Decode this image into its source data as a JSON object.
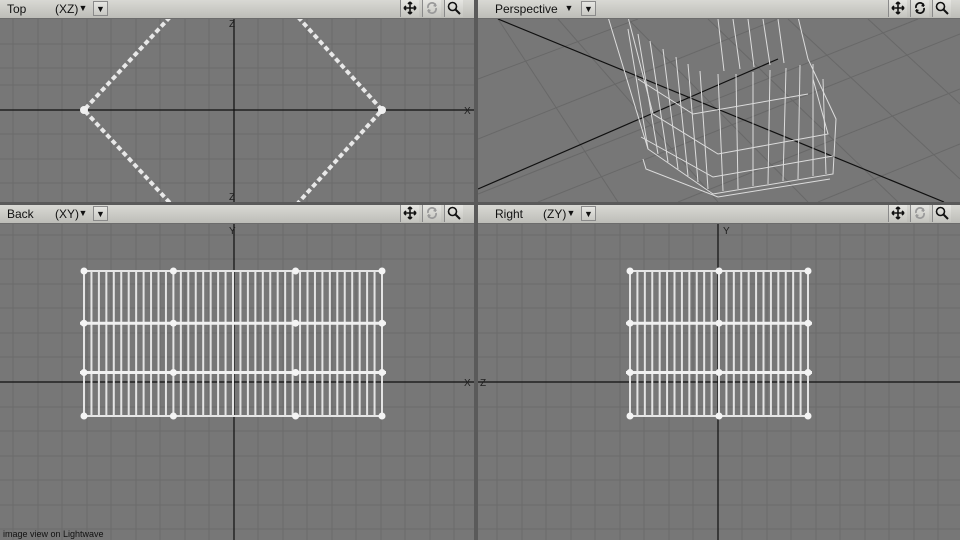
{
  "viewports": [
    {
      "id": "top",
      "label": "Top",
      "axes": "(XZ)",
      "has_axes": true
    },
    {
      "id": "perspective",
      "label": "Perspective",
      "axes": "",
      "has_axes": false
    },
    {
      "id": "back",
      "label": "Back",
      "axes": "(XY)",
      "has_axes": true
    },
    {
      "id": "right",
      "label": "Right",
      "axes": "(ZY)",
      "has_axes": true
    }
  ],
  "icons": {
    "move": "move-arrows-icon",
    "rotate": "rotate-icon",
    "zoom": "magnifier-icon",
    "dropdown": "triangle-down-icon"
  },
  "axis_labels": {
    "top": {
      "h": "X",
      "v": "Z"
    },
    "back": {
      "h": "X",
      "v": "Y"
    },
    "right": {
      "h": "Z",
      "v": "Y"
    }
  },
  "colors": {
    "viewport_bg": "#777777",
    "grid": "#6a6a6a",
    "axis": "#101010",
    "mesh": "#e6e6e6",
    "header": "#cfcfca"
  },
  "footer": "image view on Lightwave"
}
